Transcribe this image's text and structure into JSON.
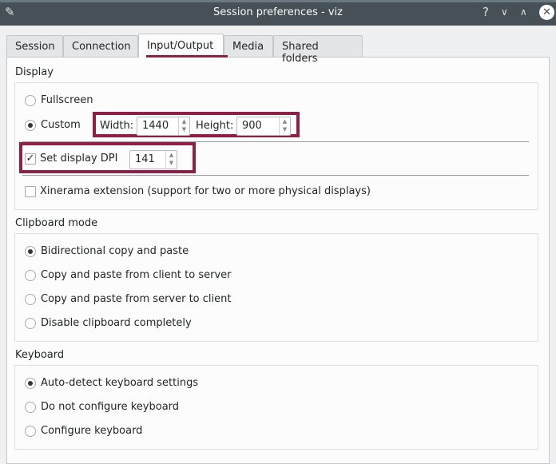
{
  "window": {
    "title": "Session preferences - viz",
    "icon": "pencil-icon",
    "buttons": [
      "help-icon",
      "minimize-icon",
      "maximize-icon",
      "close-icon"
    ]
  },
  "tabs": [
    {
      "label": "Session"
    },
    {
      "label": "Connection"
    },
    {
      "label": "Input/Output",
      "active": true
    },
    {
      "label": "Media"
    },
    {
      "label": "Shared folders"
    }
  ],
  "display": {
    "label": "Display",
    "fullscreen": "Fullscreen",
    "custom": "Custom",
    "selected": "Custom",
    "width_label": "Width:",
    "width": "1440",
    "height_label": "Height:",
    "height": "900",
    "dpi_label": "Set display DPI",
    "dpi_checked": true,
    "dpi": "141",
    "xinerama": "Xinerama extension (support for two or more physical displays)",
    "xinerama_checked": false
  },
  "clipboard": {
    "label": "Clipboard mode",
    "options": [
      "Bidirectional copy and paste",
      "Copy and paste from client to server",
      "Copy and paste from server to client",
      "Disable clipboard completely"
    ],
    "selected": 0
  },
  "keyboard": {
    "label": "Keyboard",
    "options": [
      "Auto-detect keyboard settings",
      "Do not configure keyboard",
      "Configure keyboard"
    ],
    "selected": 0
  },
  "colors": {
    "highlight": "#8e1f47",
    "titlebar": "#475057"
  }
}
